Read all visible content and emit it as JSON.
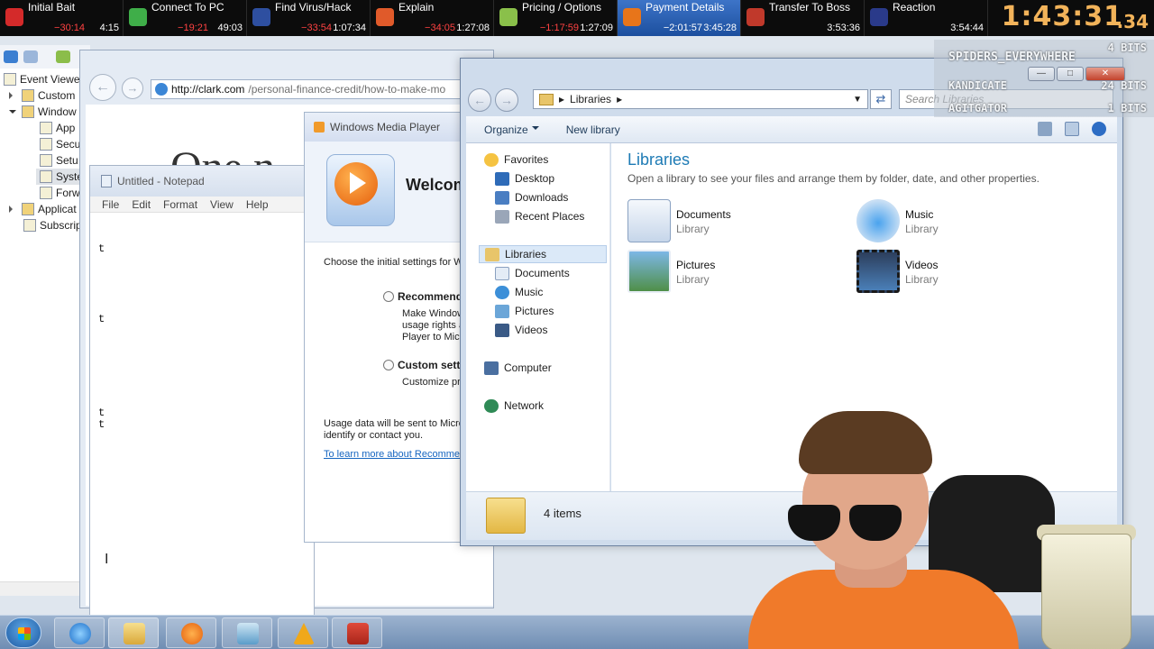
{
  "splits": [
    {
      "name": "Initial Bait",
      "delta": "−30:14",
      "time": "4:15",
      "color": "#d42a2a"
    },
    {
      "name": "Connect To PC",
      "delta": "−19:21",
      "time": "49:03",
      "color": "#3fae49"
    },
    {
      "name": "Find Virus/Hack",
      "delta": "−33:54",
      "time": "1:07:34",
      "color": "#2e4fa0"
    },
    {
      "name": "Explain",
      "delta": "−34:05",
      "time": "1:27:08",
      "color": "#e05a2a"
    },
    {
      "name": "Pricing / Options",
      "delta": "−1:17:59",
      "time": "1:27:09",
      "color": "#8ac04a"
    },
    {
      "name": "Payment Details",
      "delta": "−2:01:57",
      "time": "3:45:28",
      "color": "#e8751a"
    },
    {
      "name": "Transfer To Boss",
      "delta": "",
      "time": "3:53:36",
      "color": "#c0392b"
    },
    {
      "name": "Reaction",
      "delta": "",
      "time": "3:54:44",
      "color": "#2a3a8a"
    }
  ],
  "timer": {
    "main": "1:43:31",
    "ms": ".34"
  },
  "event_viewer": {
    "items": [
      {
        "label": "Event Viewer",
        "depth": 0,
        "expander": "none"
      },
      {
        "label": "Custom",
        "depth": 1,
        "expander": "closed"
      },
      {
        "label": "Window",
        "depth": 1,
        "expander": "open"
      },
      {
        "label": "App",
        "depth": 2,
        "expander": "none"
      },
      {
        "label": "Secu",
        "depth": 2,
        "expander": "none"
      },
      {
        "label": "Setu",
        "depth": 2,
        "expander": "none"
      },
      {
        "label": "Syste",
        "depth": 2,
        "expander": "none"
      },
      {
        "label": "Forw",
        "depth": 2,
        "expander": "none"
      },
      {
        "label": "Applicat",
        "depth": 1,
        "expander": "closed"
      },
      {
        "label": "Subscrip",
        "depth": 1,
        "expander": "none"
      }
    ]
  },
  "browser": {
    "url_domain": "http://clark.com",
    "url_path": "/personal-finance-credit/how-to-make-mo",
    "page_heading": "One n"
  },
  "notepad": {
    "title": "Untitled - Notepad",
    "menu": [
      "File",
      "Edit",
      "Format",
      "View",
      "Help"
    ],
    "text": "t\n\n\n\n\n\nt\n\n\n\n\n\n\n\nt\nt"
  },
  "wmp": {
    "title": "Windows Media Player",
    "welcome": "Welcom",
    "intro": "Choose the initial settings for W",
    "recommended_label": "Recommend",
    "recommended_desc": [
      "Make Window",
      "usage rights a",
      "Player to Micr"
    ],
    "custom_label": "Custom sett",
    "custom_desc": "Customize pri",
    "usage_note": [
      "Usage data will be sent to Micro",
      "identify or contact you."
    ],
    "learn_more": "To learn more about Recommen"
  },
  "explorer": {
    "breadcrumb": "Libraries",
    "search_placeholder": "Search Libraries",
    "organize": "Organize",
    "new_library": "New library",
    "heading": "Libraries",
    "description": "Open a library to see your files and arrange them by folder, date, and other properties.",
    "nav": {
      "favorites": "Favorites",
      "desktop": "Desktop",
      "downloads": "Downloads",
      "recent": "Recent Places",
      "libraries": "Libraries",
      "documents": "Documents",
      "music": "Music",
      "pictures": "Pictures",
      "videos": "Videos",
      "computer": "Computer",
      "network": "Network"
    },
    "libraries": [
      {
        "name": "Documents",
        "type": "Library"
      },
      {
        "name": "Music",
        "type": "Library"
      },
      {
        "name": "Pictures",
        "type": "Library"
      },
      {
        "name": "Videos",
        "type": "Library"
      }
    ],
    "status": "4 items"
  },
  "overlay": {
    "top_bits": "4 BITS",
    "rows": [
      {
        "name": "SPIDERS_EVERYWHERE",
        "bits": ""
      },
      {
        "name": "KANDICATE",
        "bits": "24 BITS"
      },
      {
        "name": "AGITGATOR",
        "bits": "1 BITS"
      }
    ]
  },
  "taskbar": {
    "items": [
      "internet-explorer",
      "windows-explorer",
      "windows-media-player",
      "notepad",
      "app-a",
      "toolbox"
    ]
  },
  "colors": {
    "active_split": "#2f64b4",
    "timer": "#f2b35a",
    "delta_negative": "#ff4242",
    "library_heading": "#1e7bb5"
  }
}
